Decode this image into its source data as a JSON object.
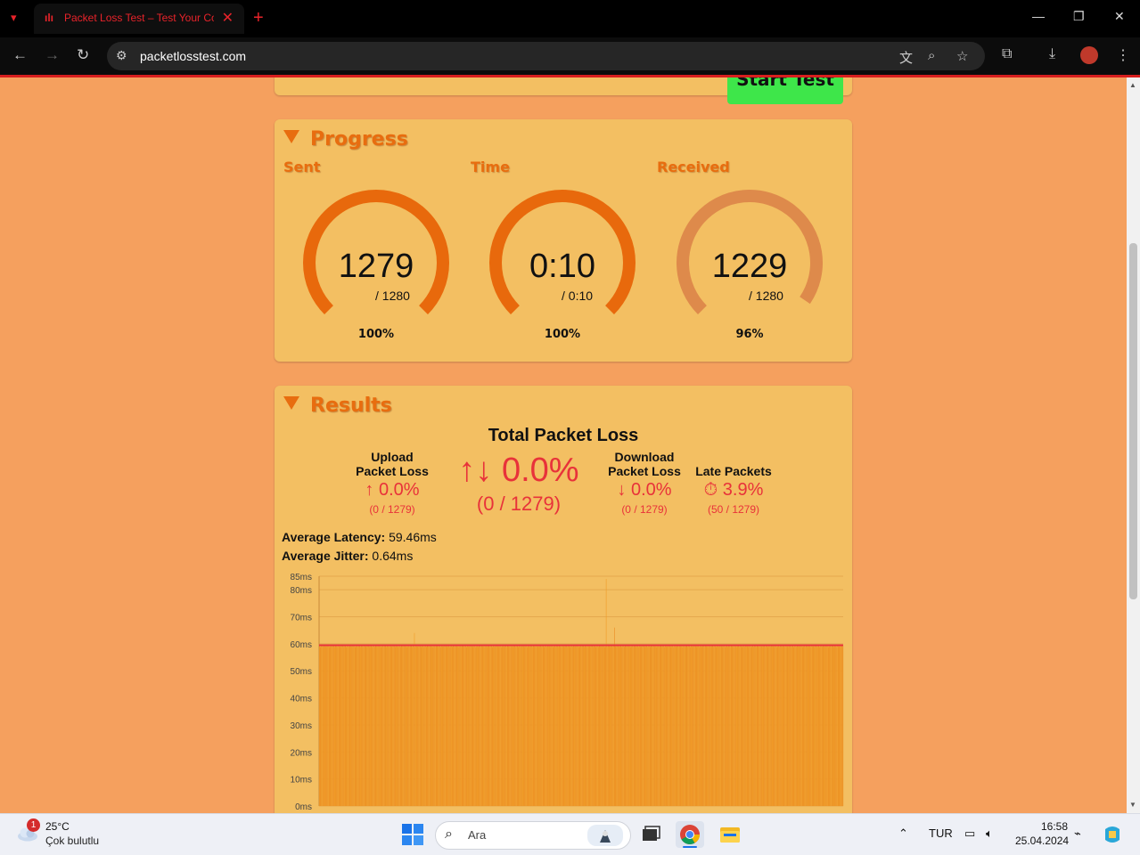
{
  "browser": {
    "tab_title": "Packet Loss Test – Test Your Co",
    "url": "packetlosstest.com"
  },
  "top_panel": {
    "start_button": "Start Test"
  },
  "progress": {
    "heading": "Progress",
    "gauges": [
      {
        "label": "Sent",
        "value": "1279",
        "total": "/ 1280",
        "percent": "100%",
        "fraction": 1.0,
        "color": "#e8690c"
      },
      {
        "label": "Time",
        "value": "0:10",
        "total": "/ 0:10",
        "percent": "100%",
        "fraction": 1.0,
        "color": "#e8690c"
      },
      {
        "label": "Received",
        "value": "1229",
        "total": "/ 1280",
        "percent": "96%",
        "fraction": 0.96,
        "color": "#de8a4b"
      }
    ]
  },
  "results": {
    "heading": "Results",
    "total_title": "Total Packet Loss",
    "upload": {
      "heading_1": "Upload",
      "heading_2": "Packet Loss",
      "value": "↑ 0.0%",
      "sub": "(0 / 1279)"
    },
    "total": {
      "value": "↑↓ 0.0%",
      "sub": "(0 / 1279)"
    },
    "download": {
      "heading_1": "Download",
      "heading_2": "Packet Loss",
      "value": "↓ 0.0%",
      "sub": "(0 / 1279)"
    },
    "late": {
      "heading": "Late Packets",
      "value": "⏱ 3.9%",
      "sub": "(50 / 1279)"
    },
    "avg_latency_label": "Average Latency:",
    "avg_latency_value": "59.46ms",
    "avg_jitter_label": "Average Jitter:",
    "avg_jitter_value": "0.64ms"
  },
  "chart_data": {
    "type": "bar",
    "y_ticks": [
      "85ms",
      "80ms",
      "70ms",
      "60ms",
      "50ms",
      "40ms",
      "30ms",
      "20ms",
      "10ms",
      "0ms"
    ],
    "ylim": [
      0,
      85
    ],
    "bar_count": 1279,
    "typical_value": 59.5,
    "average_line": 59.46,
    "spikes": [
      {
        "index": 700,
        "value": 84
      },
      {
        "index": 720,
        "value": 66
      },
      {
        "index": 232,
        "value": 64
      }
    ],
    "colors": {
      "bar": "#f09c2a",
      "bar_alt": "#ea8c22",
      "average_line": "#e8323a"
    }
  },
  "taskbar": {
    "weather_temp": "25°C",
    "weather_desc": "Çok bulutlu",
    "weather_badge": "1",
    "search_placeholder": "Ara",
    "language": "TUR",
    "time": "16:58",
    "date": "25.04.2024"
  }
}
